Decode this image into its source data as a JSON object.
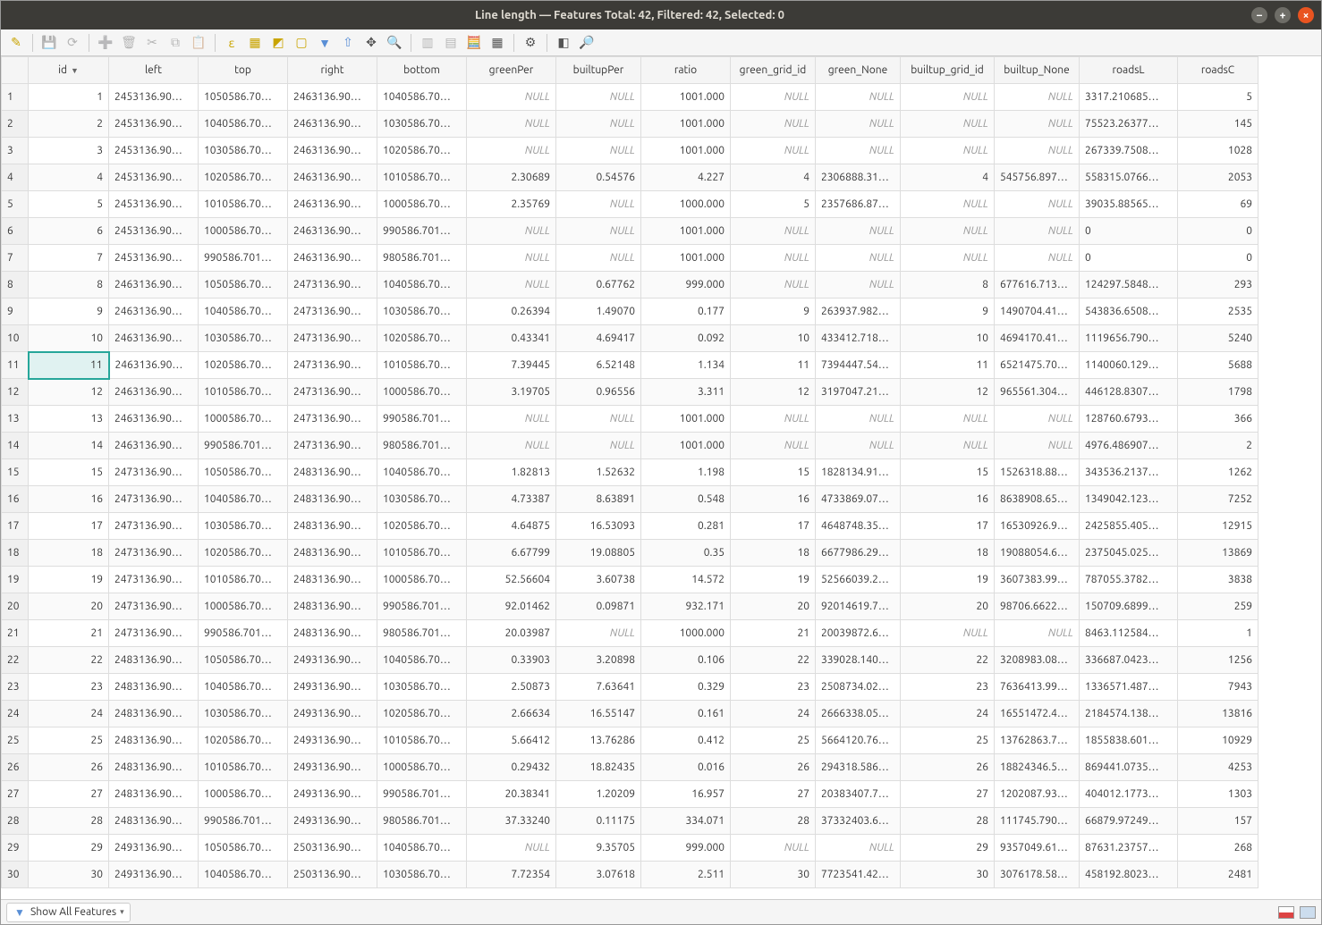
{
  "window": {
    "title": "Line length — Features Total: 42, Filtered: 42, Selected: 0"
  },
  "columns": [
    "id",
    "left",
    "top",
    "right",
    "bottom",
    "greenPer",
    "builtupPer",
    "ratio",
    "green_grid_id",
    "green_None",
    "builtup_grid_id",
    "builtup_None",
    "roadsL",
    "roadsC"
  ],
  "selected_cell": {
    "row": 11,
    "col": "id"
  },
  "rows": [
    {
      "n": 1,
      "id": "1",
      "left": "2453136.90…",
      "top": "1050586.70…",
      "right": "2463136.90…",
      "bottom": "1040586.70…",
      "greenPer": null,
      "builtupPer": null,
      "ratio": "1001.000",
      "green_grid_id": null,
      "green_None": null,
      "builtup_grid_id": null,
      "builtup_None": null,
      "roadsL": "3317.210685…",
      "roadsC": "5"
    },
    {
      "n": 2,
      "id": "2",
      "left": "2453136.90…",
      "top": "1040586.70…",
      "right": "2463136.90…",
      "bottom": "1030586.70…",
      "greenPer": null,
      "builtupPer": null,
      "ratio": "1001.000",
      "green_grid_id": null,
      "green_None": null,
      "builtup_grid_id": null,
      "builtup_None": null,
      "roadsL": "75523.26377…",
      "roadsC": "145"
    },
    {
      "n": 3,
      "id": "3",
      "left": "2453136.90…",
      "top": "1030586.70…",
      "right": "2463136.90…",
      "bottom": "1020586.70…",
      "greenPer": null,
      "builtupPer": null,
      "ratio": "1001.000",
      "green_grid_id": null,
      "green_None": null,
      "builtup_grid_id": null,
      "builtup_None": null,
      "roadsL": "267339.7508…",
      "roadsC": "1028"
    },
    {
      "n": 4,
      "id": "4",
      "left": "2453136.90…",
      "top": "1020586.70…",
      "right": "2463136.90…",
      "bottom": "1010586.70…",
      "greenPer": "2.30689",
      "builtupPer": "0.54576",
      "ratio": "4.227",
      "green_grid_id": "4",
      "green_None": "2306888.31…",
      "builtup_grid_id": "4",
      "builtup_None": "545756.897…",
      "roadsL": "558315.0766…",
      "roadsC": "2053"
    },
    {
      "n": 5,
      "id": "5",
      "left": "2453136.90…",
      "top": "1010586.70…",
      "right": "2463136.90…",
      "bottom": "1000586.70…",
      "greenPer": "2.35769",
      "builtupPer": null,
      "ratio": "1000.000",
      "green_grid_id": "5",
      "green_None": "2357686.87…",
      "builtup_grid_id": null,
      "builtup_None": null,
      "roadsL": "39035.88565…",
      "roadsC": "69"
    },
    {
      "n": 6,
      "id": "6",
      "left": "2453136.90…",
      "top": "1000586.70…",
      "right": "2463136.90…",
      "bottom": "990586.701…",
      "greenPer": null,
      "builtupPer": null,
      "ratio": "1001.000",
      "green_grid_id": null,
      "green_None": null,
      "builtup_grid_id": null,
      "builtup_None": null,
      "roadsL": "0",
      "roadsC": "0"
    },
    {
      "n": 7,
      "id": "7",
      "left": "2453136.90…",
      "top": "990586.701…",
      "right": "2463136.90…",
      "bottom": "980586.701…",
      "greenPer": null,
      "builtupPer": null,
      "ratio": "1001.000",
      "green_grid_id": null,
      "green_None": null,
      "builtup_grid_id": null,
      "builtup_None": null,
      "roadsL": "0",
      "roadsC": "0"
    },
    {
      "n": 8,
      "id": "8",
      "left": "2463136.90…",
      "top": "1050586.70…",
      "right": "2473136.90…",
      "bottom": "1040586.70…",
      "greenPer": null,
      "builtupPer": "0.67762",
      "ratio": "999.000",
      "green_grid_id": null,
      "green_None": null,
      "builtup_grid_id": "8",
      "builtup_None": "677616.713…",
      "roadsL": "124297.5848…",
      "roadsC": "293"
    },
    {
      "n": 9,
      "id": "9",
      "left": "2463136.90…",
      "top": "1040586.70…",
      "right": "2473136.90…",
      "bottom": "1030586.70…",
      "greenPer": "0.26394",
      "builtupPer": "1.49070",
      "ratio": "0.177",
      "green_grid_id": "9",
      "green_None": "263937.982…",
      "builtup_grid_id": "9",
      "builtup_None": "1490704.41…",
      "roadsL": "543836.6508…",
      "roadsC": "2535"
    },
    {
      "n": 10,
      "id": "10",
      "left": "2463136.90…",
      "top": "1030586.70…",
      "right": "2473136.90…",
      "bottom": "1020586.70…",
      "greenPer": "0.43341",
      "builtupPer": "4.69417",
      "ratio": "0.092",
      "green_grid_id": "10",
      "green_None": "433412.718…",
      "builtup_grid_id": "10",
      "builtup_None": "4694170.41…",
      "roadsL": "1119656.790…",
      "roadsC": "5240"
    },
    {
      "n": 11,
      "id": "11",
      "left": "2463136.90…",
      "top": "1020586.70…",
      "right": "2473136.90…",
      "bottom": "1010586.70…",
      "greenPer": "7.39445",
      "builtupPer": "6.52148",
      "ratio": "1.134",
      "green_grid_id": "11",
      "green_None": "7394447.54…",
      "builtup_grid_id": "11",
      "builtup_None": "6521475.70…",
      "roadsL": "1140060.129…",
      "roadsC": "5688"
    },
    {
      "n": 12,
      "id": "12",
      "left": "2463136.90…",
      "top": "1010586.70…",
      "right": "2473136.90…",
      "bottom": "1000586.70…",
      "greenPer": "3.19705",
      "builtupPer": "0.96556",
      "ratio": "3.311",
      "green_grid_id": "12",
      "green_None": "3197047.21…",
      "builtup_grid_id": "12",
      "builtup_None": "965561.304…",
      "roadsL": "446128.8307…",
      "roadsC": "1798"
    },
    {
      "n": 13,
      "id": "13",
      "left": "2463136.90…",
      "top": "1000586.70…",
      "right": "2473136.90…",
      "bottom": "990586.701…",
      "greenPer": null,
      "builtupPer": null,
      "ratio": "1001.000",
      "green_grid_id": null,
      "green_None": null,
      "builtup_grid_id": null,
      "builtup_None": null,
      "roadsL": "128760.6793…",
      "roadsC": "366"
    },
    {
      "n": 14,
      "id": "14",
      "left": "2463136.90…",
      "top": "990586.701…",
      "right": "2473136.90…",
      "bottom": "980586.701…",
      "greenPer": null,
      "builtupPer": null,
      "ratio": "1001.000",
      "green_grid_id": null,
      "green_None": null,
      "builtup_grid_id": null,
      "builtup_None": null,
      "roadsL": "4976.486907…",
      "roadsC": "2"
    },
    {
      "n": 15,
      "id": "15",
      "left": "2473136.90…",
      "top": "1050586.70…",
      "right": "2483136.90…",
      "bottom": "1040586.70…",
      "greenPer": "1.82813",
      "builtupPer": "1.52632",
      "ratio": "1.198",
      "green_grid_id": "15",
      "green_None": "1828134.91…",
      "builtup_grid_id": "15",
      "builtup_None": "1526318.88…",
      "roadsL": "343536.2137…",
      "roadsC": "1262"
    },
    {
      "n": 16,
      "id": "16",
      "left": "2473136.90…",
      "top": "1040586.70…",
      "right": "2483136.90…",
      "bottom": "1030586.70…",
      "greenPer": "4.73387",
      "builtupPer": "8.63891",
      "ratio": "0.548",
      "green_grid_id": "16",
      "green_None": "4733869.07…",
      "builtup_grid_id": "16",
      "builtup_None": "8638908.65…",
      "roadsL": "1349042.123…",
      "roadsC": "7252"
    },
    {
      "n": 17,
      "id": "17",
      "left": "2473136.90…",
      "top": "1030586.70…",
      "right": "2483136.90…",
      "bottom": "1020586.70…",
      "greenPer": "4.64875",
      "builtupPer": "16.53093",
      "ratio": "0.281",
      "green_grid_id": "17",
      "green_None": "4648748.35…",
      "builtup_grid_id": "17",
      "builtup_None": "16530926.9…",
      "roadsL": "2425855.405…",
      "roadsC": "12915"
    },
    {
      "n": 18,
      "id": "18",
      "left": "2473136.90…",
      "top": "1020586.70…",
      "right": "2483136.90…",
      "bottom": "1010586.70…",
      "greenPer": "6.67799",
      "builtupPer": "19.08805",
      "ratio": "0.35",
      "green_grid_id": "18",
      "green_None": "6677986.29…",
      "builtup_grid_id": "18",
      "builtup_None": "19088054.6…",
      "roadsL": "2375045.025…",
      "roadsC": "13869"
    },
    {
      "n": 19,
      "id": "19",
      "left": "2473136.90…",
      "top": "1010586.70…",
      "right": "2483136.90…",
      "bottom": "1000586.70…",
      "greenPer": "52.56604",
      "builtupPer": "3.60738",
      "ratio": "14.572",
      "green_grid_id": "19",
      "green_None": "52566039.2…",
      "builtup_grid_id": "19",
      "builtup_None": "3607383.99…",
      "roadsL": "787055.3782…",
      "roadsC": "3838"
    },
    {
      "n": 20,
      "id": "20",
      "left": "2473136.90…",
      "top": "1000586.70…",
      "right": "2483136.90…",
      "bottom": "990586.701…",
      "greenPer": "92.01462",
      "builtupPer": "0.09871",
      "ratio": "932.171",
      "green_grid_id": "20",
      "green_None": "92014619.7…",
      "builtup_grid_id": "20",
      "builtup_None": "98706.6622…",
      "roadsL": "150709.6899…",
      "roadsC": "259"
    },
    {
      "n": 21,
      "id": "21",
      "left": "2473136.90…",
      "top": "990586.701…",
      "right": "2483136.90…",
      "bottom": "980586.701…",
      "greenPer": "20.03987",
      "builtupPer": null,
      "ratio": "1000.000",
      "green_grid_id": "21",
      "green_None": "20039872.6…",
      "builtup_grid_id": null,
      "builtup_None": null,
      "roadsL": "8463.112584…",
      "roadsC": "1"
    },
    {
      "n": 22,
      "id": "22",
      "left": "2483136.90…",
      "top": "1050586.70…",
      "right": "2493136.90…",
      "bottom": "1040586.70…",
      "greenPer": "0.33903",
      "builtupPer": "3.20898",
      "ratio": "0.106",
      "green_grid_id": "22",
      "green_None": "339028.140…",
      "builtup_grid_id": "22",
      "builtup_None": "3208983.08…",
      "roadsL": "336687.0423…",
      "roadsC": "1256"
    },
    {
      "n": 23,
      "id": "23",
      "left": "2483136.90…",
      "top": "1040586.70…",
      "right": "2493136.90…",
      "bottom": "1030586.70…",
      "greenPer": "2.50873",
      "builtupPer": "7.63641",
      "ratio": "0.329",
      "green_grid_id": "23",
      "green_None": "2508734.02…",
      "builtup_grid_id": "23",
      "builtup_None": "7636413.99…",
      "roadsL": "1336571.487…",
      "roadsC": "7943"
    },
    {
      "n": 24,
      "id": "24",
      "left": "2483136.90…",
      "top": "1030586.70…",
      "right": "2493136.90…",
      "bottom": "1020586.70…",
      "greenPer": "2.66634",
      "builtupPer": "16.55147",
      "ratio": "0.161",
      "green_grid_id": "24",
      "green_None": "2666338.05…",
      "builtup_grid_id": "24",
      "builtup_None": "16551472.4…",
      "roadsL": "2184574.138…",
      "roadsC": "13816"
    },
    {
      "n": 25,
      "id": "25",
      "left": "2483136.90…",
      "top": "1020586.70…",
      "right": "2493136.90…",
      "bottom": "1010586.70…",
      "greenPer": "5.66412",
      "builtupPer": "13.76286",
      "ratio": "0.412",
      "green_grid_id": "25",
      "green_None": "5664120.76…",
      "builtup_grid_id": "25",
      "builtup_None": "13762863.7…",
      "roadsL": "1855838.601…",
      "roadsC": "10929"
    },
    {
      "n": 26,
      "id": "26",
      "left": "2483136.90…",
      "top": "1010586.70…",
      "right": "2493136.90…",
      "bottom": "1000586.70…",
      "greenPer": "0.29432",
      "builtupPer": "18.82435",
      "ratio": "0.016",
      "green_grid_id": "26",
      "green_None": "294318.586…",
      "builtup_grid_id": "26",
      "builtup_None": "18824346.5…",
      "roadsL": "869441.0735…",
      "roadsC": "4253"
    },
    {
      "n": 27,
      "id": "27",
      "left": "2483136.90…",
      "top": "1000586.70…",
      "right": "2493136.90…",
      "bottom": "990586.701…",
      "greenPer": "20.38341",
      "builtupPer": "1.20209",
      "ratio": "16.957",
      "green_grid_id": "27",
      "green_None": "20383407.7…",
      "builtup_grid_id": "27",
      "builtup_None": "1202087.93…",
      "roadsL": "404012.1773…",
      "roadsC": "1303"
    },
    {
      "n": 28,
      "id": "28",
      "left": "2483136.90…",
      "top": "990586.701…",
      "right": "2493136.90…",
      "bottom": "980586.701…",
      "greenPer": "37.33240",
      "builtupPer": "0.11175",
      "ratio": "334.071",
      "green_grid_id": "28",
      "green_None": "37332403.6…",
      "builtup_grid_id": "28",
      "builtup_None": "111745.790…",
      "roadsL": "66879.97249…",
      "roadsC": "157"
    },
    {
      "n": 29,
      "id": "29",
      "left": "2493136.90…",
      "top": "1050586.70…",
      "right": "2503136.90…",
      "bottom": "1040586.70…",
      "greenPer": null,
      "builtupPer": "9.35705",
      "ratio": "999.000",
      "green_grid_id": null,
      "green_None": null,
      "builtup_grid_id": "29",
      "builtup_None": "9357049.61…",
      "roadsL": "87631.23757…",
      "roadsC": "268"
    },
    {
      "n": 30,
      "id": "30",
      "left": "2493136.90…",
      "top": "1040586.70…",
      "right": "2503136.90…",
      "bottom": "1030586.70…",
      "greenPer": "7.72354",
      "builtupPer": "3.07618",
      "ratio": "2.511",
      "green_grid_id": "30",
      "green_None": "7723541.42…",
      "builtup_grid_id": "30",
      "builtup_None": "3076178.58…",
      "roadsL": "458192.8023…",
      "roadsC": "2481"
    }
  ],
  "footer": {
    "filter_label": "Show All Features"
  },
  "null_text": "NULL"
}
